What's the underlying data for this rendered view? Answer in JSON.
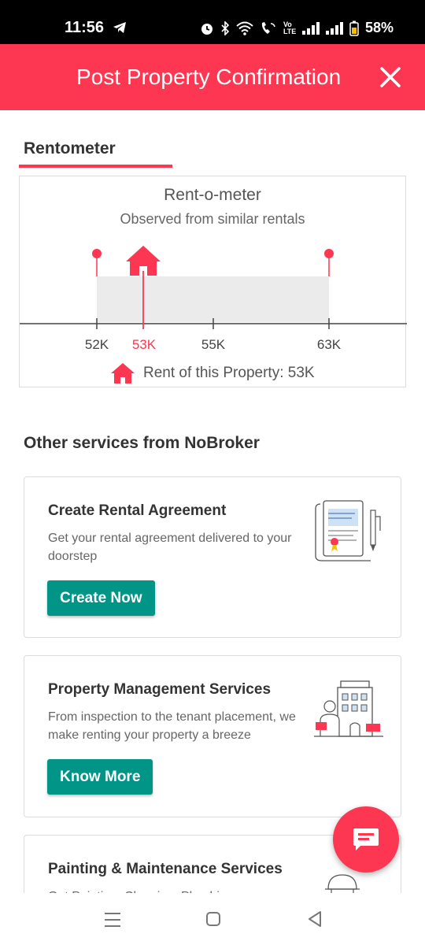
{
  "status": {
    "time": "11:56",
    "battery": "58%",
    "volte": "Vo LTE"
  },
  "header": {
    "title": "Post Property Confirmation",
    "close_icon": "close-icon"
  },
  "tab": {
    "label": "Rentometer"
  },
  "rentometer": {
    "title": "Rent-o-meter",
    "subtitle": "Observed from similar rentals",
    "ticks": [
      "52K",
      "53K",
      "55K",
      "63K"
    ],
    "range_min": "52K",
    "range_max": "63K",
    "property_rent": "53K",
    "footer": "Rent of this Property: 53K",
    "accent_color": "#fd3752"
  },
  "chart_data": {
    "type": "bar",
    "title": "Rent-o-meter",
    "subtitle": "Observed from similar rentals",
    "xlabel": "",
    "ylabel": "",
    "x_ticks": [
      52,
      53,
      55,
      63
    ],
    "x_tick_labels": [
      "52K",
      "53K",
      "55K",
      "63K"
    ],
    "xlim": [
      52,
      63
    ],
    "range": {
      "min": 52,
      "max": 63
    },
    "marker": {
      "value": 53,
      "label": "53K"
    },
    "annotation": "Rent of this Property: 53K"
  },
  "services": {
    "title": "Other services from NoBroker",
    "items": [
      {
        "title": "Create Rental Agreement",
        "description": "Get your rental agreement delivered to your doorstep",
        "button": "Create Now",
        "icon": "rental-agreement-illustration"
      },
      {
        "title": "Property Management Services",
        "description": "From inspection to the tenant placement, we make renting your property a breeze",
        "button": "Know More",
        "icon": "property-management-illustration"
      },
      {
        "title": "Painting & Maintenance Services",
        "description": "Get Painting, Cleaning, Plumbing",
        "icon": "painter-illustration"
      }
    ],
    "button_color": "#009587"
  },
  "fab": {
    "icon": "chat-icon"
  }
}
